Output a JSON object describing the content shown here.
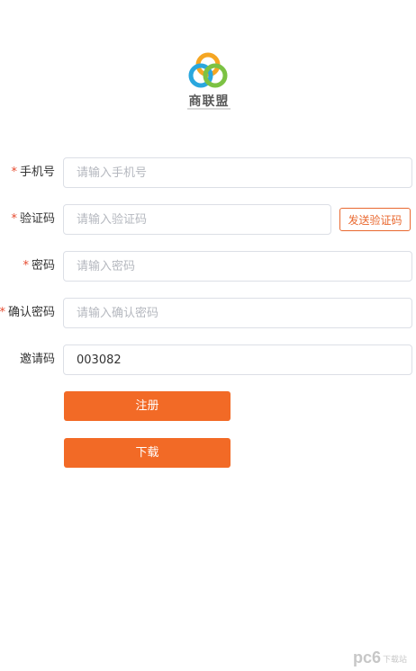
{
  "logo": {
    "name": "商联盟",
    "colors": [
      "#f5a623",
      "#2aa7de",
      "#7cc243"
    ]
  },
  "form": {
    "phone": {
      "required": "*",
      "label": "手机号",
      "placeholder": "请输入手机号",
      "value": ""
    },
    "code": {
      "required": "*",
      "label": "验证码",
      "placeholder": "请输入验证码",
      "value": "",
      "send_button": "发送验证码"
    },
    "password": {
      "required": "*",
      "label": "密码",
      "placeholder": "请输入密码",
      "value": ""
    },
    "confirm": {
      "required": "*",
      "label": "确认密码",
      "placeholder": "请输入确认密码",
      "value": ""
    },
    "invite": {
      "label": "邀请码",
      "placeholder": "",
      "value": "003082"
    }
  },
  "buttons": {
    "register": "注册",
    "download": "下载"
  },
  "watermark": {
    "text": "pc6",
    "sub": "下载站"
  },
  "theme": {
    "accent": "#f26a26",
    "required": "#e64a2f"
  }
}
